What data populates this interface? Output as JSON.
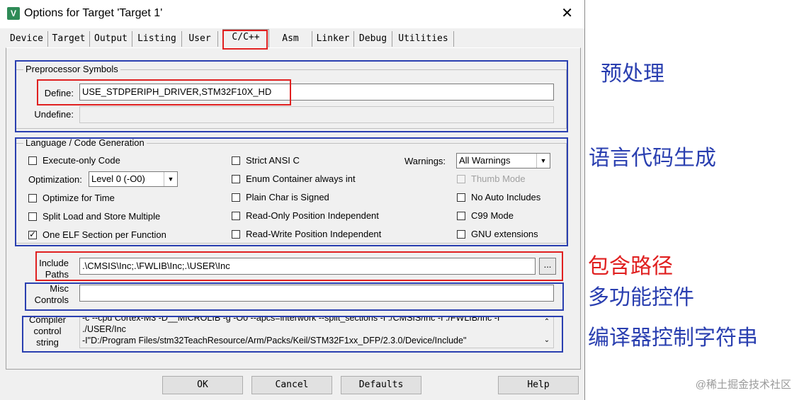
{
  "window": {
    "icon": "V",
    "title": "Options for Target 'Target 1'",
    "close": "✕"
  },
  "tabs": [
    "Device",
    "Target",
    "Output",
    "Listing",
    "User",
    "C/C++",
    "Asm",
    "Linker",
    "Debug",
    "Utilities"
  ],
  "active_tab": "C/C++",
  "preprocessor": {
    "group_title": "Preprocessor Symbols",
    "define_label": "Define:",
    "define_value": "USE_STDPERIPH_DRIVER,STM32F10X_HD",
    "undefine_label": "Undefine:",
    "undefine_value": ""
  },
  "language": {
    "group_title": "Language / Code Generation",
    "execute_only": {
      "label": "Execute-only Code",
      "checked": false
    },
    "optimization_label": "Optimization:",
    "optimization_value": "Level 0 (-O0)",
    "optimize_time": {
      "label": "Optimize for Time",
      "checked": false
    },
    "split_load": {
      "label": "Split Load and Store Multiple",
      "checked": false
    },
    "one_elf": {
      "label": "One ELF Section per Function",
      "checked": true
    },
    "strict_ansi": {
      "label": "Strict ANSI C",
      "checked": false
    },
    "enum_container": {
      "label": "Enum Container always int",
      "checked": false
    },
    "plain_char": {
      "label": "Plain Char is Signed",
      "checked": false
    },
    "ropi": {
      "label": "Read-Only Position Independent",
      "checked": false
    },
    "rwpi": {
      "label": "Read-Write Position Independent",
      "checked": false
    },
    "warnings_label": "Warnings:",
    "warnings_value": "All Warnings",
    "thumb_mode": {
      "label": "Thumb Mode",
      "checked": false
    },
    "no_auto_includes": {
      "label": "No Auto Includes",
      "checked": false
    },
    "c99_mode": {
      "label": "C99 Mode",
      "checked": false
    },
    "gnu_extensions": {
      "label": "GNU extensions",
      "checked": false
    }
  },
  "include": {
    "label_line1": "Include",
    "label_line2": "Paths",
    "value": ".\\CMSIS\\Inc;.\\FWLIB\\Inc;.\\USER\\Inc",
    "browse": "..."
  },
  "misc": {
    "label_line1": "Misc",
    "label_line2": "Controls",
    "value": ""
  },
  "compiler": {
    "label_line1": "Compiler",
    "label_line2": "control",
    "label_line3": "string",
    "line1": "-c --cpu Cortex-M3 -D__MICROLIB -g -O0 --apcs=interwork --split_sections -I ./CMSIS/Inc -I ./FWLIB/Inc -I",
    "line2": "./USER/Inc",
    "line3": "-I\"D:/Program Files/stm32TeachResource/Arm/Packs/Keil/STM32F1xx_DFP/2.3.0/Device/Include\""
  },
  "buttons": {
    "ok": "OK",
    "cancel": "Cancel",
    "defaults": "Defaults",
    "help": "Help"
  },
  "annotations": {
    "preprocess": "预处理",
    "codegen": "语言代码生成",
    "include_path": "包含路径",
    "misc_controls": "多功能控件",
    "compiler_string": "编译器控制字符串"
  },
  "annotation_colors": {
    "red": "#e02020",
    "blue": "#2a3fb0"
  },
  "watermark": "@稀土掘金技术社区"
}
